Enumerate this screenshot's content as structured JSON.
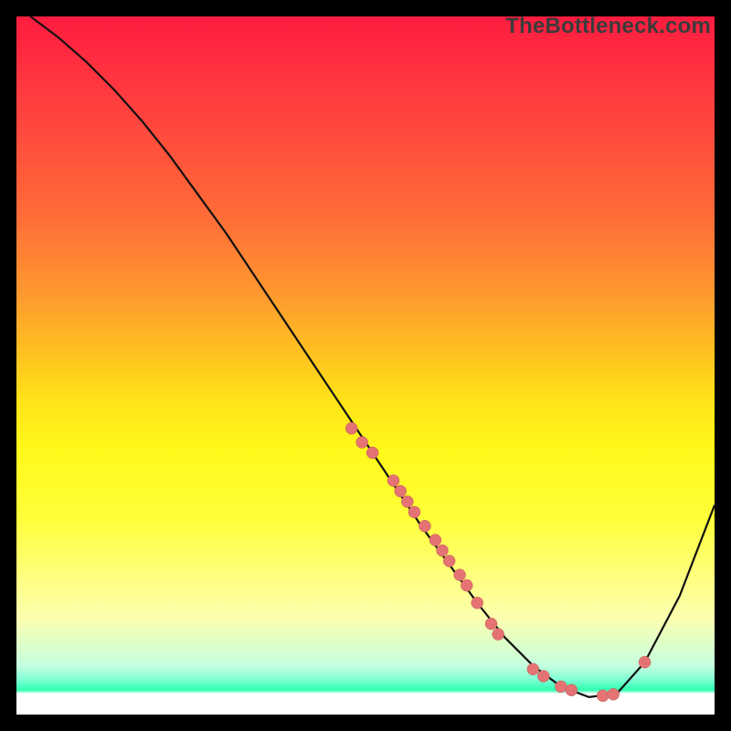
{
  "watermark": "TheBottleneck.com",
  "chart_data": {
    "type": "line",
    "title": "",
    "xlabel": "",
    "ylabel": "",
    "xlim": [
      0,
      100
    ],
    "ylim": [
      0,
      100
    ],
    "series": [
      {
        "name": "curve",
        "x": [
          2,
          6,
          10,
          14,
          18,
          22,
          26,
          30,
          34,
          38,
          42,
          46,
          50,
          54,
          58,
          62,
          66,
          70,
          74,
          78,
          82,
          86,
          90,
          95,
          100
        ],
        "y": [
          100,
          97,
          93.5,
          89.5,
          85,
          80,
          74.5,
          69,
          63,
          57,
          51,
          45,
          39,
          33,
          27,
          21.5,
          16,
          11,
          7,
          4,
          2.5,
          3,
          7.5,
          17,
          30
        ]
      }
    ],
    "points": [
      {
        "x": 48,
        "y": 41
      },
      {
        "x": 49.5,
        "y": 39
      },
      {
        "x": 51,
        "y": 37.5
      },
      {
        "x": 54,
        "y": 33.5
      },
      {
        "x": 55,
        "y": 32
      },
      {
        "x": 56,
        "y": 30.5
      },
      {
        "x": 57,
        "y": 29
      },
      {
        "x": 58.5,
        "y": 27
      },
      {
        "x": 60,
        "y": 25
      },
      {
        "x": 61,
        "y": 23.5
      },
      {
        "x": 62,
        "y": 22
      },
      {
        "x": 63.5,
        "y": 20
      },
      {
        "x": 64.5,
        "y": 18.5
      },
      {
        "x": 66,
        "y": 16
      },
      {
        "x": 68,
        "y": 13
      },
      {
        "x": 69,
        "y": 11.5
      },
      {
        "x": 74,
        "y": 6.5
      },
      {
        "x": 75.5,
        "y": 5.5
      },
      {
        "x": 78,
        "y": 4
      },
      {
        "x": 79.5,
        "y": 3.5
      },
      {
        "x": 84,
        "y": 2.7
      },
      {
        "x": 85.5,
        "y": 2.9
      },
      {
        "x": 90,
        "y": 7.5
      }
    ],
    "dot_radius": 6.5,
    "dot_color": "#e57373",
    "line_color": "#111111"
  }
}
